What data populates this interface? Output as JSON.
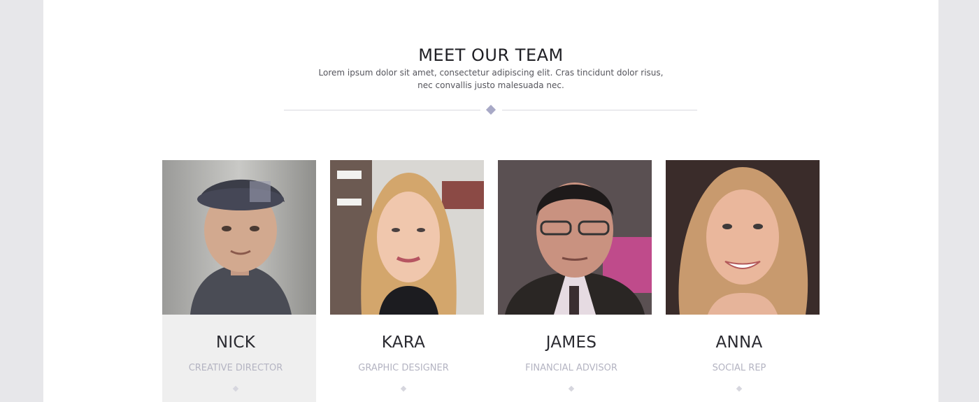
{
  "section": {
    "title": "MEET OUR TEAM",
    "subtitle": "Lorem ipsum dolor sit amet, consectetur adipiscing elit. Cras tincidunt dolor risus, nec convallis justo malesuada nec."
  },
  "team": [
    {
      "name": "NICK",
      "role": "CREATIVE DIRECTOR"
    },
    {
      "name": "KARA",
      "role": "GRAPHIC DESIGNER"
    },
    {
      "name": "JAMES",
      "role": "FINANCIAL ADVISOR"
    },
    {
      "name": "ANNA",
      "role": "SOCIAL REP"
    }
  ],
  "colors": {
    "accent_diamond": "#a8a9c6",
    "active_card_bg": "#efefef",
    "role_text": "#b4b4c2"
  }
}
